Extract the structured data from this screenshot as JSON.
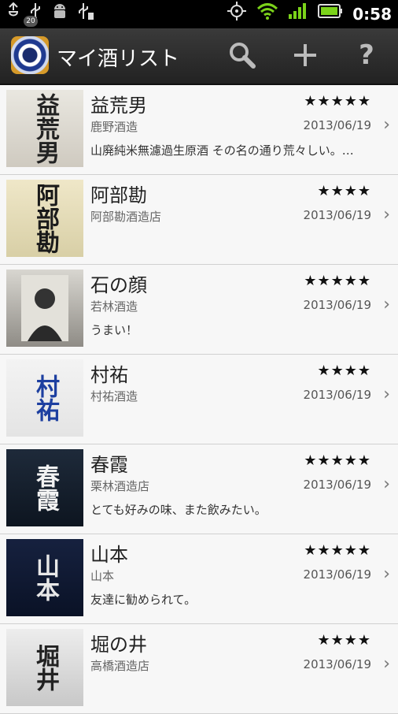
{
  "status_bar": {
    "badge": "20",
    "time": "0:58",
    "icons": [
      "notification-icon",
      "usb-icon",
      "android-debug-icon",
      "usb-storage-icon",
      "gps-icon",
      "wifi-icon",
      "signal-icon",
      "battery-icon"
    ]
  },
  "action_bar": {
    "title": "マイ酒リスト",
    "search_icon": "search-icon",
    "add_icon": "add-icon",
    "help_label": "?"
  },
  "colors": {
    "status_bg": "#000000",
    "actionbar_bg": "#2a2a2a",
    "list_bg": "#f7f7f7"
  },
  "items": [
    {
      "name": "益荒男",
      "brewery": "鹿野酒造",
      "note": "山廃純米無濾過生原酒 その名の通り荒々しい。…",
      "stars": "★★★★★",
      "date": "2013/06/19",
      "thumb_text": "益荒男",
      "thumb_style": "light"
    },
    {
      "name": "阿部勘",
      "brewery": "阿部勘酒造店",
      "note": "",
      "stars": "★★★★",
      "date": "2013/06/19",
      "thumb_text": "阿部勘",
      "thumb_style": "cream"
    },
    {
      "name": "石の顔",
      "brewery": "若林酒造",
      "note": "うまい！",
      "stars": "★★★★★",
      "date": "2013/06/19",
      "thumb_text": "",
      "thumb_style": "grey"
    },
    {
      "name": "村祐",
      "brewery": "村祐酒造",
      "note": "",
      "stars": "★★★★",
      "date": "2013/06/19",
      "thumb_text": "村祐",
      "thumb_style": "blue"
    },
    {
      "name": "春霞",
      "brewery": "栗林酒造店",
      "note": "とても好みの味、また飲みたい。",
      "stars": "★★★★★",
      "date": "2013/06/19",
      "thumb_text": "春霞",
      "thumb_style": "dark"
    },
    {
      "name": "山本",
      "brewery": "山本",
      "note": "友達に勧められて。",
      "stars": "★★★★★",
      "date": "2013/06/19",
      "thumb_text": "山本",
      "thumb_style": "navy"
    },
    {
      "name": "堀の井",
      "brewery": "高橋酒造店",
      "note": "",
      "stars": "★★★★",
      "date": "2013/06/19",
      "thumb_text": "堀井",
      "thumb_style": "white"
    }
  ]
}
